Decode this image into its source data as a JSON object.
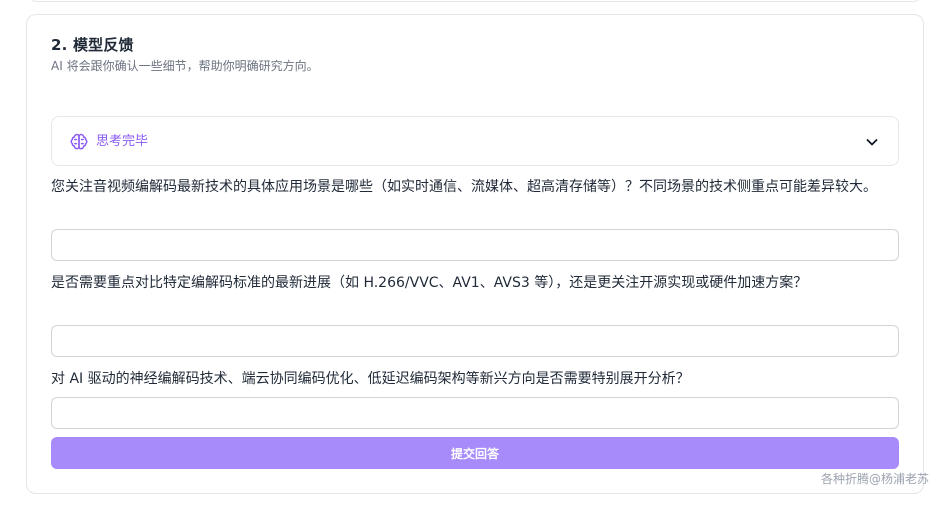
{
  "section": {
    "title": "2. 模型反馈",
    "subtitle": "AI 将会跟你确认一些细节，帮助你明确研究方向。"
  },
  "thinking": {
    "label": "思考完毕",
    "icon": "brain-icon",
    "expand_icon": "chevron-down-icon"
  },
  "questions": [
    {
      "text": "您关注音视频编解码最新技术的具体应用场景是哪些（如实时通信、流媒体、超高清存储等）？不同场景的技术侧重点可能差异较大。",
      "answer": ""
    },
    {
      "text": "是否需要重点对比特定编解码标准的最新进展（如 H.266/VVC、AV1、AVS3 等），还是更关注开源实现或硬件加速方案？",
      "answer": ""
    },
    {
      "text": "对 AI 驱动的神经编解码技术、端云协同编码优化、低延迟编码架构等新兴方向是否需要特别展开分析？",
      "answer": ""
    }
  ],
  "submit_label": "提交回答",
  "watermark": "各种折腾@杨浦老苏",
  "colors": {
    "accent": "#8b5cf6",
    "button": "#a78bfa",
    "border": "#e5e7eb"
  }
}
